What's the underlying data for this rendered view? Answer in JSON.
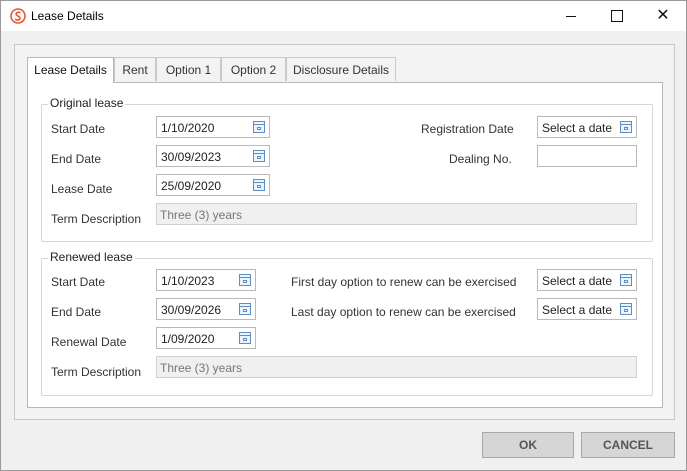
{
  "window": {
    "title": "Lease Details"
  },
  "tabs": [
    {
      "label": "Lease Details"
    },
    {
      "label": "Rent"
    },
    {
      "label": "Option 1"
    },
    {
      "label": "Option 2"
    },
    {
      "label": "Disclosure Details"
    }
  ],
  "original": {
    "title": "Original lease",
    "start_label": "Start Date",
    "start_value": "1/10/2020",
    "end_label": "End Date",
    "end_value": "30/09/2023",
    "lease_label": "Lease Date",
    "lease_value": "25/09/2020",
    "term_label": "Term Description",
    "term_value": "Three (3) years",
    "reg_label": "Registration Date",
    "reg_value": "Select a date",
    "dealing_label": "Dealing No.",
    "dealing_value": ""
  },
  "renewed": {
    "title": "Renewed lease",
    "start_label": "Start Date",
    "start_value": "1/10/2023",
    "end_label": "End Date",
    "end_value": "30/09/2026",
    "renewal_label": "Renewal Date",
    "renewal_value": "1/09/2020",
    "term_label": "Term Description",
    "term_value": "Three (3) years",
    "first_label": "First day option to renew can be exercised",
    "first_value": "Select a date",
    "last_label": "Last day option to renew can be exercised",
    "last_value": "Select a date"
  },
  "buttons": {
    "ok": "OK",
    "cancel": "CANCEL"
  },
  "colors": {
    "accent": "#5a8fc7",
    "app_icon": "#e8582c"
  }
}
